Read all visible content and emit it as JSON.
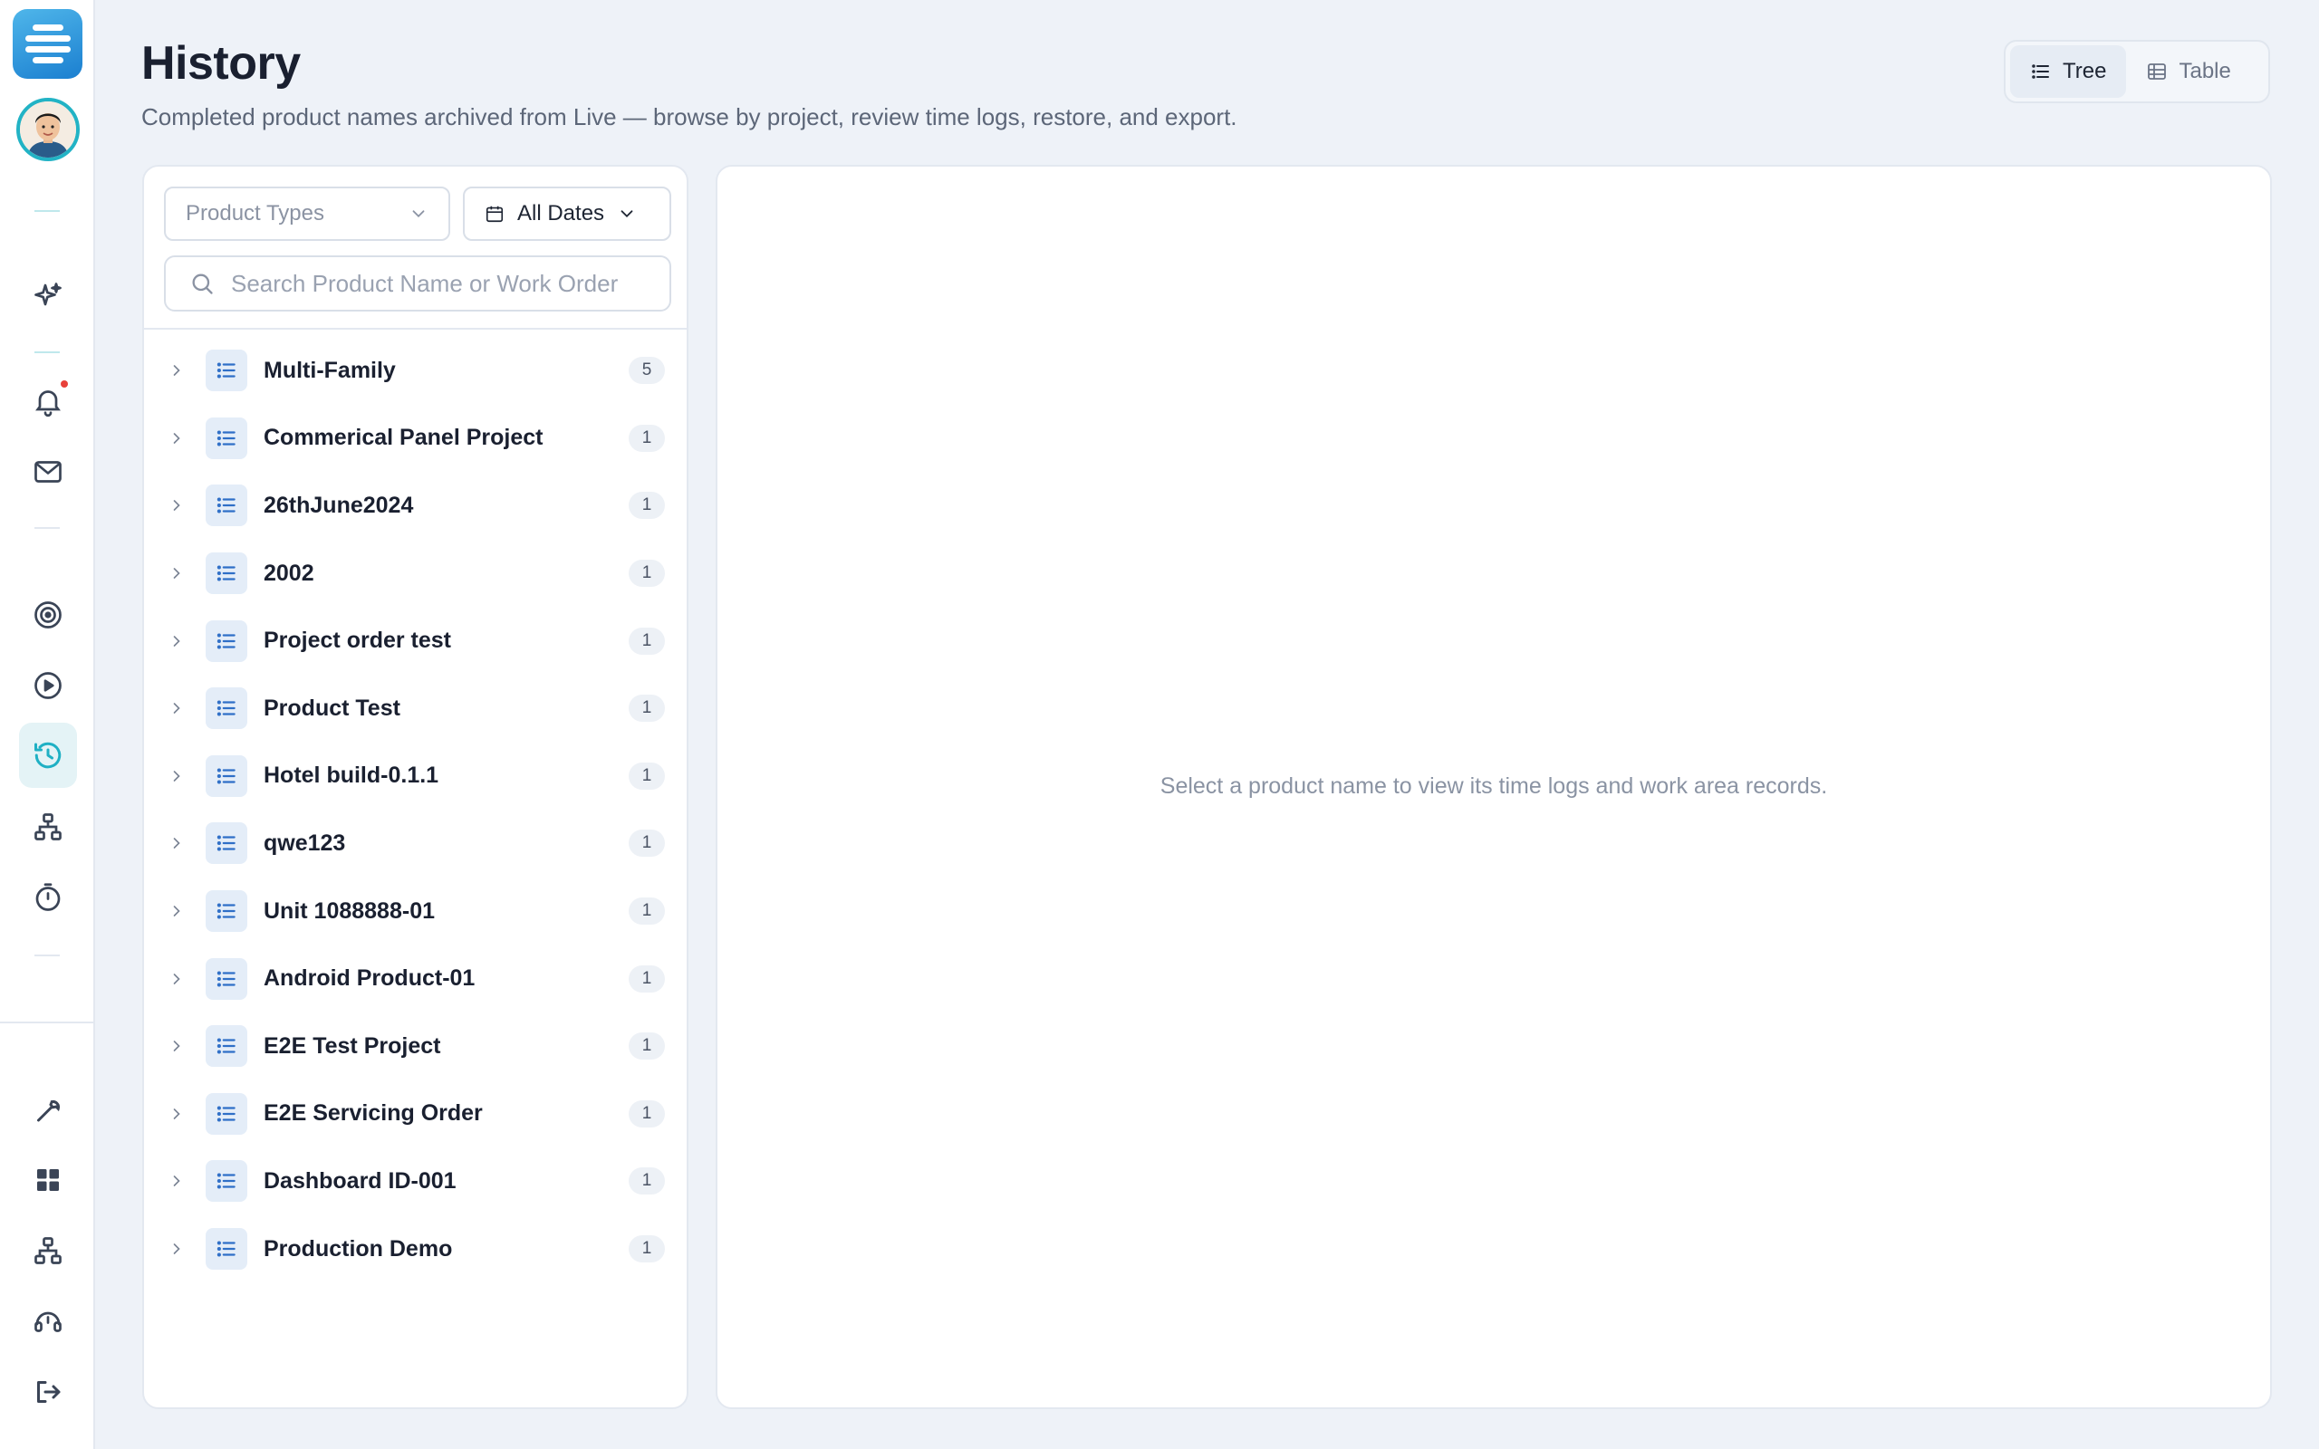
{
  "header": {
    "title": "History",
    "subtitle": "Completed product names archived from Live — browse by project, review time logs, restore, and export."
  },
  "view_toggle": {
    "tree_label": "Tree",
    "table_label": "Table",
    "active": "Tree"
  },
  "filters": {
    "product_types_placeholder": "Product Types",
    "dates_value": "All Dates",
    "search_placeholder": "Search Product Name or Work Order"
  },
  "tree": {
    "items": [
      {
        "label": "Multi-Family",
        "count": "5"
      },
      {
        "label": "Commerical Panel Project",
        "count": "1"
      },
      {
        "label": "26thJune2024",
        "count": "1"
      },
      {
        "label": "2002",
        "count": "1"
      },
      {
        "label": "Project order test",
        "count": "1"
      },
      {
        "label": "Product Test",
        "count": "1"
      },
      {
        "label": "Hotel build-0.1.1",
        "count": "1"
      },
      {
        "label": "qwe123",
        "count": "1"
      },
      {
        "label": "Unit 1088888-01",
        "count": "1"
      },
      {
        "label": "Android Product-01",
        "count": "1"
      },
      {
        "label": "E2E Test Project",
        "count": "1"
      },
      {
        "label": "E2E Servicing Order",
        "count": "1"
      },
      {
        "label": "Dashboard ID-001",
        "count": "1"
      },
      {
        "label": "Production Demo",
        "count": "1"
      }
    ]
  },
  "detail": {
    "empty_message": "Select a product name to view its time logs and work area records."
  },
  "sidebar": {
    "icons": [
      "app-logo",
      "user-avatar",
      "sparkles-icon",
      "bell-icon",
      "mail-icon",
      "target-icon",
      "play-circle-icon",
      "history-icon",
      "network-icon",
      "timer-icon",
      "wrench-icon",
      "dashboard-grid-icon",
      "org-chart-icon",
      "support-icon",
      "logout-icon"
    ],
    "active": "history-icon"
  },
  "colors": {
    "accent": "#22b3c5",
    "background": "#eef2f8",
    "notification": "#e8413a"
  }
}
